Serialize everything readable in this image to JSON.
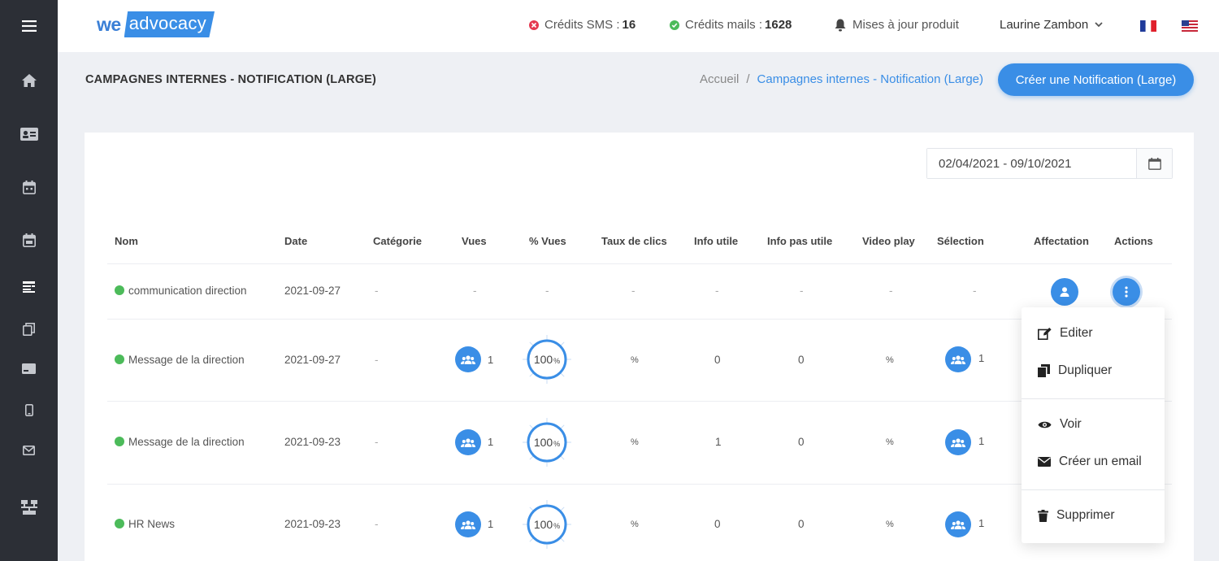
{
  "topbar": {
    "logo_we": "we",
    "logo_advocacy": "advocacy",
    "sms_label": "Crédits SMS :",
    "sms_value": "16",
    "mails_label": "Crédits mails :",
    "mails_value": "1628",
    "updates_label": "Mises à jour produit",
    "user_name": "Laurine Zambon"
  },
  "page": {
    "title": "CAMPAGNES INTERNES - NOTIFICATION (LARGE)",
    "breadcrumb_home": "Accueil",
    "breadcrumb_sep": "/",
    "breadcrumb_current": "Campagnes internes - Notification (Large)",
    "create_button": "Créer une Notification (Large)"
  },
  "filters": {
    "date_range": "02/04/2021 - 09/10/2021"
  },
  "table": {
    "headers": [
      "Nom",
      "Date",
      "Catégorie",
      "Vues",
      "% Vues",
      "Taux de clics",
      "Info utile",
      "Info pas utile",
      "Video play",
      "Sélection",
      "Affectation",
      "Actions"
    ],
    "rows": [
      {
        "name": "communication direction",
        "date": "2021-09-27",
        "category": "-",
        "views": "-",
        "pct_views": "-",
        "click_rate": "-",
        "useful": "-",
        "not_useful": "-",
        "video_play": "-",
        "selection": "-"
      },
      {
        "name": "Message de la direction",
        "date": "2021-09-27",
        "category": "-",
        "views": "1",
        "pct_views": "100",
        "pct_unit": "%",
        "click_rate": "%",
        "useful": "0",
        "not_useful": "0",
        "video_play": "%",
        "selection": "1"
      },
      {
        "name": "Message de la direction",
        "date": "2021-09-23",
        "category": "-",
        "views": "1",
        "pct_views": "100",
        "pct_unit": "%",
        "click_rate": "%",
        "useful": "1",
        "not_useful": "0",
        "video_play": "%",
        "selection": "1"
      },
      {
        "name": "HR News",
        "date": "2021-09-23",
        "category": "-",
        "views": "1",
        "pct_views": "100",
        "pct_unit": "%",
        "click_rate": "%",
        "useful": "0",
        "not_useful": "0",
        "video_play": "%",
        "selection": "1"
      }
    ]
  },
  "actions_menu": {
    "edit": "Editer",
    "duplicate": "Dupliquer",
    "view": "Voir",
    "create_email": "Créer un email",
    "delete": "Supprimer"
  },
  "colors": {
    "accent": "#3a8ee6",
    "sidebar": "#2c2f36",
    "status_active": "#4cbb5a",
    "sms_badge": "#e53950",
    "mail_badge": "#4cbb5a"
  },
  "icons": {
    "sidebar": [
      "menu-icon",
      "home-icon",
      "id-card-icon",
      "calendar-icon",
      "calendar-event-icon",
      "list-icon",
      "copy-icon",
      "card-icon",
      "mobile-icon",
      "mail-icon",
      "network-icon"
    ]
  }
}
